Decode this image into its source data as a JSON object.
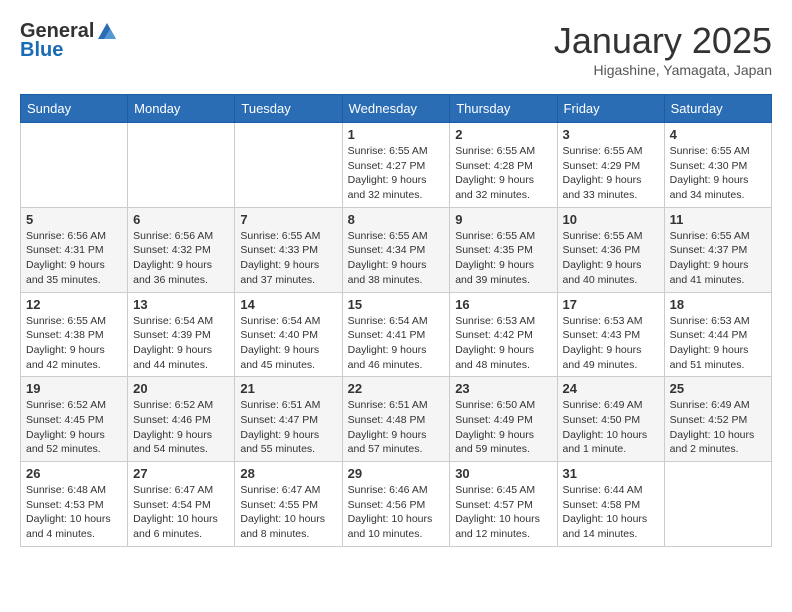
{
  "header": {
    "logo_general": "General",
    "logo_blue": "Blue",
    "title": "January 2025",
    "location": "Higashine, Yamagata, Japan"
  },
  "weekdays": [
    "Sunday",
    "Monday",
    "Tuesday",
    "Wednesday",
    "Thursday",
    "Friday",
    "Saturday"
  ],
  "weeks": [
    [
      {
        "day": "",
        "info": ""
      },
      {
        "day": "",
        "info": ""
      },
      {
        "day": "",
        "info": ""
      },
      {
        "day": "1",
        "info": "Sunrise: 6:55 AM\nSunset: 4:27 PM\nDaylight: 9 hours and 32 minutes."
      },
      {
        "day": "2",
        "info": "Sunrise: 6:55 AM\nSunset: 4:28 PM\nDaylight: 9 hours and 32 minutes."
      },
      {
        "day": "3",
        "info": "Sunrise: 6:55 AM\nSunset: 4:29 PM\nDaylight: 9 hours and 33 minutes."
      },
      {
        "day": "4",
        "info": "Sunrise: 6:55 AM\nSunset: 4:30 PM\nDaylight: 9 hours and 34 minutes."
      }
    ],
    [
      {
        "day": "5",
        "info": "Sunrise: 6:56 AM\nSunset: 4:31 PM\nDaylight: 9 hours and 35 minutes."
      },
      {
        "day": "6",
        "info": "Sunrise: 6:56 AM\nSunset: 4:32 PM\nDaylight: 9 hours and 36 minutes."
      },
      {
        "day": "7",
        "info": "Sunrise: 6:55 AM\nSunset: 4:33 PM\nDaylight: 9 hours and 37 minutes."
      },
      {
        "day": "8",
        "info": "Sunrise: 6:55 AM\nSunset: 4:34 PM\nDaylight: 9 hours and 38 minutes."
      },
      {
        "day": "9",
        "info": "Sunrise: 6:55 AM\nSunset: 4:35 PM\nDaylight: 9 hours and 39 minutes."
      },
      {
        "day": "10",
        "info": "Sunrise: 6:55 AM\nSunset: 4:36 PM\nDaylight: 9 hours and 40 minutes."
      },
      {
        "day": "11",
        "info": "Sunrise: 6:55 AM\nSunset: 4:37 PM\nDaylight: 9 hours and 41 minutes."
      }
    ],
    [
      {
        "day": "12",
        "info": "Sunrise: 6:55 AM\nSunset: 4:38 PM\nDaylight: 9 hours and 42 minutes."
      },
      {
        "day": "13",
        "info": "Sunrise: 6:54 AM\nSunset: 4:39 PM\nDaylight: 9 hours and 44 minutes."
      },
      {
        "day": "14",
        "info": "Sunrise: 6:54 AM\nSunset: 4:40 PM\nDaylight: 9 hours and 45 minutes."
      },
      {
        "day": "15",
        "info": "Sunrise: 6:54 AM\nSunset: 4:41 PM\nDaylight: 9 hours and 46 minutes."
      },
      {
        "day": "16",
        "info": "Sunrise: 6:53 AM\nSunset: 4:42 PM\nDaylight: 9 hours and 48 minutes."
      },
      {
        "day": "17",
        "info": "Sunrise: 6:53 AM\nSunset: 4:43 PM\nDaylight: 9 hours and 49 minutes."
      },
      {
        "day": "18",
        "info": "Sunrise: 6:53 AM\nSunset: 4:44 PM\nDaylight: 9 hours and 51 minutes."
      }
    ],
    [
      {
        "day": "19",
        "info": "Sunrise: 6:52 AM\nSunset: 4:45 PM\nDaylight: 9 hours and 52 minutes."
      },
      {
        "day": "20",
        "info": "Sunrise: 6:52 AM\nSunset: 4:46 PM\nDaylight: 9 hours and 54 minutes."
      },
      {
        "day": "21",
        "info": "Sunrise: 6:51 AM\nSunset: 4:47 PM\nDaylight: 9 hours and 55 minutes."
      },
      {
        "day": "22",
        "info": "Sunrise: 6:51 AM\nSunset: 4:48 PM\nDaylight: 9 hours and 57 minutes."
      },
      {
        "day": "23",
        "info": "Sunrise: 6:50 AM\nSunset: 4:49 PM\nDaylight: 9 hours and 59 minutes."
      },
      {
        "day": "24",
        "info": "Sunrise: 6:49 AM\nSunset: 4:50 PM\nDaylight: 10 hours and 1 minute."
      },
      {
        "day": "25",
        "info": "Sunrise: 6:49 AM\nSunset: 4:52 PM\nDaylight: 10 hours and 2 minutes."
      }
    ],
    [
      {
        "day": "26",
        "info": "Sunrise: 6:48 AM\nSunset: 4:53 PM\nDaylight: 10 hours and 4 minutes."
      },
      {
        "day": "27",
        "info": "Sunrise: 6:47 AM\nSunset: 4:54 PM\nDaylight: 10 hours and 6 minutes."
      },
      {
        "day": "28",
        "info": "Sunrise: 6:47 AM\nSunset: 4:55 PM\nDaylight: 10 hours and 8 minutes."
      },
      {
        "day": "29",
        "info": "Sunrise: 6:46 AM\nSunset: 4:56 PM\nDaylight: 10 hours and 10 minutes."
      },
      {
        "day": "30",
        "info": "Sunrise: 6:45 AM\nSunset: 4:57 PM\nDaylight: 10 hours and 12 minutes."
      },
      {
        "day": "31",
        "info": "Sunrise: 6:44 AM\nSunset: 4:58 PM\nDaylight: 10 hours and 14 minutes."
      },
      {
        "day": "",
        "info": ""
      }
    ]
  ]
}
